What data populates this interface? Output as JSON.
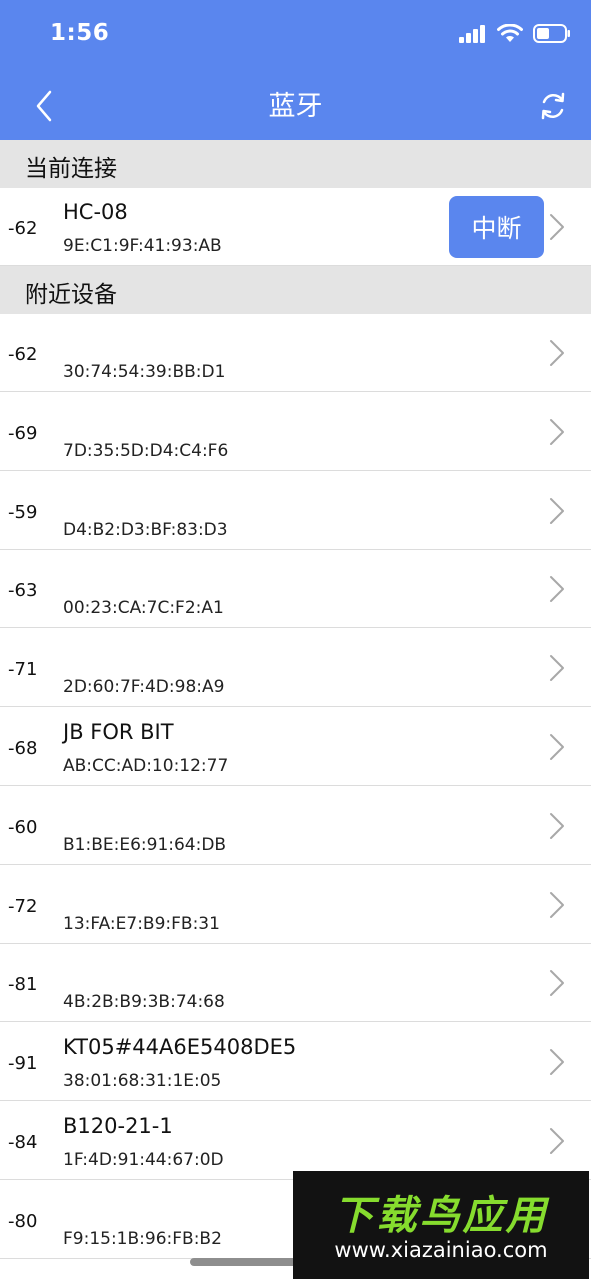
{
  "status_bar": {
    "time": "1:56"
  },
  "nav": {
    "title": "蓝牙"
  },
  "current_section": {
    "label": "当前连接"
  },
  "current_device": {
    "rssi": "-62",
    "name": "HC-08",
    "mac": "9E:C1:9F:41:93:AB",
    "action_label": "中断"
  },
  "nearby_section": {
    "label": "附近设备"
  },
  "devices": [
    {
      "rssi": "-62",
      "name": "",
      "mac": "30:74:54:39:BB:D1"
    },
    {
      "rssi": "-69",
      "name": "",
      "mac": "7D:35:5D:D4:C4:F6"
    },
    {
      "rssi": "-59",
      "name": "",
      "mac": "D4:B2:D3:BF:83:D3"
    },
    {
      "rssi": "-63",
      "name": "",
      "mac": "00:23:CA:7C:F2:A1"
    },
    {
      "rssi": "-71",
      "name": "",
      "mac": "2D:60:7F:4D:98:A9"
    },
    {
      "rssi": "-68",
      "name": "JB FOR BIT",
      "mac": "AB:CC:AD:10:12:77"
    },
    {
      "rssi": "-60",
      "name": "",
      "mac": "B1:BE:E6:91:64:DB"
    },
    {
      "rssi": "-72",
      "name": "",
      "mac": "13:FA:E7:B9:FB:31"
    },
    {
      "rssi": "-81",
      "name": "",
      "mac": "4B:2B:B9:3B:74:68"
    },
    {
      "rssi": "-91",
      "name": "KT05#44A6E5408DE5",
      "mac": "38:01:68:31:1E:05"
    },
    {
      "rssi": "-84",
      "name": "B120-21-1",
      "mac": "1F:4D:91:44:67:0D"
    },
    {
      "rssi": "-80",
      "name": "",
      "mac": "F9:15:1B:96:FB:B2"
    }
  ],
  "watermark": {
    "logo": "下载鸟应用",
    "url": "www.xiazainiao.com"
  },
  "colors": {
    "accent": "#5a86ee",
    "section_bg": "#e4e4e4"
  },
  "icons": {
    "back": "chevron-left-icon",
    "refresh": "refresh-icon",
    "row_chevron": "chevron-right-icon"
  }
}
